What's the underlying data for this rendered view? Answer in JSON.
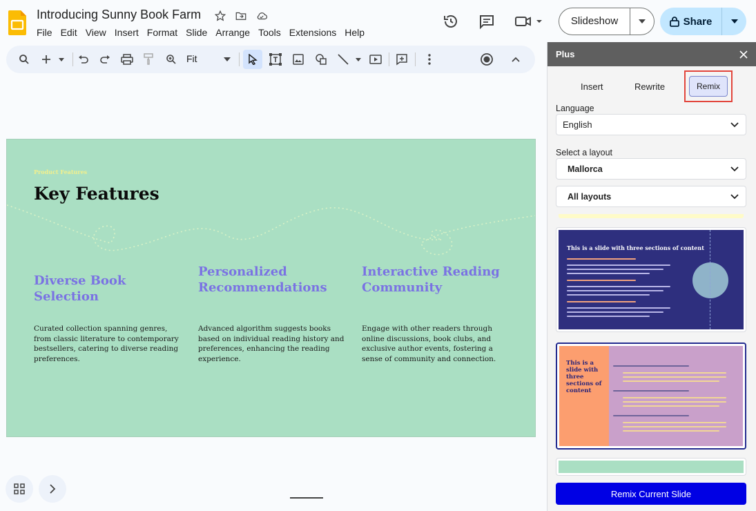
{
  "header": {
    "title": "Introducing Sunny Book Farm",
    "menu": [
      "File",
      "Edit",
      "View",
      "Insert",
      "Format",
      "Slide",
      "Arrange",
      "Tools",
      "Extensions",
      "Help"
    ],
    "slideshow_label": "Slideshow",
    "share_label": "Share"
  },
  "toolbar": {
    "zoom": "Fit"
  },
  "slide": {
    "kicker": "Product Features",
    "title": "Key Features",
    "columns": [
      {
        "heading": "Diverse Book Selection",
        "body": "Curated collection spanning genres, from classic literature to contemporary bestsellers, catering to diverse reading preferences."
      },
      {
        "heading": "Personalized Recommendations",
        "body": "Advanced algorithm suggests books based on individual reading history and preferences, enhancing the reading experience."
      },
      {
        "heading": "Interactive Reading Community",
        "body": "Engage with other readers through online discussions, book clubs, and exclusive author events, fostering a sense of community and connection."
      }
    ]
  },
  "panel": {
    "title": "Plus",
    "tabs": [
      "Insert",
      "Rewrite",
      "Remix"
    ],
    "language_label": "Language",
    "language_value": "English",
    "layout_label": "Select a layout",
    "layout_value": "Mallorca",
    "layout_filter": "All layouts",
    "thumb1_title": "This is a slide with three sections of content",
    "thumb2_title": "This is a slide with three sections of content",
    "remix_button": "Remix Current Slide"
  },
  "colors": {
    "slide_bg": "#aadfc3",
    "heading_accent": "#7a72e3",
    "remix_button": "#0000e4",
    "share_bg": "#c2e7ff"
  }
}
